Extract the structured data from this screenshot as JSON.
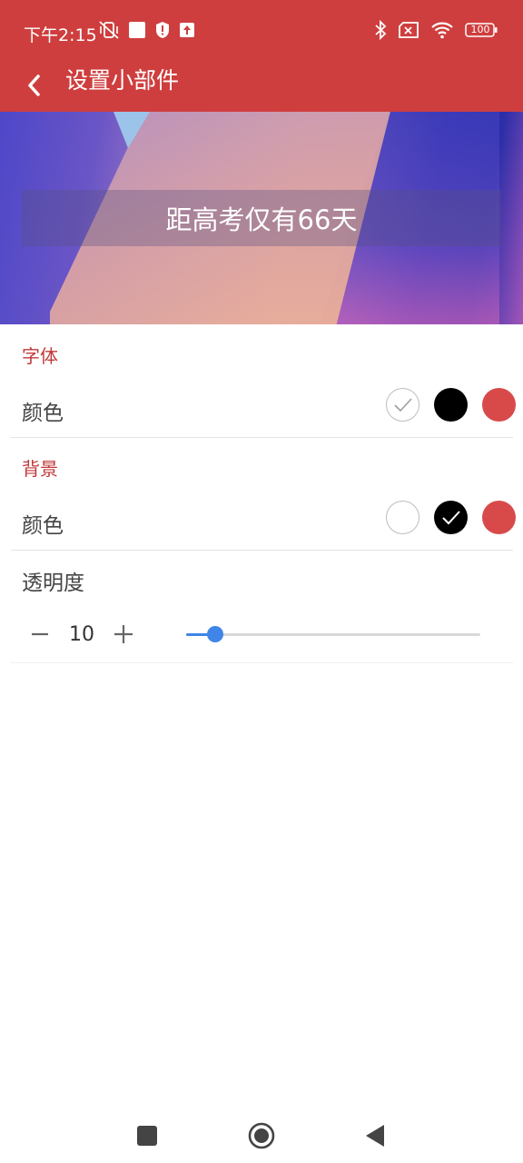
{
  "status": {
    "time": "下午2:15",
    "battery": "100",
    "left_icons": [
      "vibrate-off-icon",
      "notification-square-icon",
      "shield-alert-icon",
      "upload-icon"
    ],
    "right_icons": [
      "bluetooth-icon",
      "sim-off-icon",
      "wifi-icon",
      "battery-icon"
    ]
  },
  "appbar": {
    "title": "设置小部件",
    "back_icon": "back-chevron-icon"
  },
  "preview": {
    "text": "距高考仅有66天"
  },
  "font_section": {
    "title": "字体",
    "color_label": "颜色",
    "colors": [
      "#ffffff",
      "#000000",
      "#d84a4a"
    ],
    "selected": "#ffffff"
  },
  "background_section": {
    "title": "背景",
    "color_label": "颜色",
    "colors": [
      "#ffffff",
      "#000000",
      "#d84a4a"
    ],
    "selected": "#000000"
  },
  "opacity": {
    "label": "透明度",
    "value": "10",
    "slider_fraction": 0.1,
    "minus_icon": "minus-icon",
    "plus_icon": "plus-icon"
  },
  "colors": {
    "primary": "#cf3e3e",
    "section_title": "#c0393b",
    "slider": "#3f86e8"
  },
  "navbar": {
    "icons": [
      "recents-square-icon",
      "home-circle-icon",
      "back-triangle-icon"
    ]
  }
}
